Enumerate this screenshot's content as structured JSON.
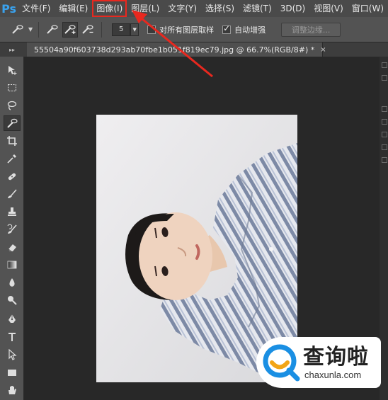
{
  "app": {
    "logo": "Ps"
  },
  "menu": {
    "items": [
      {
        "label": "文件(F)"
      },
      {
        "label": "编辑(E)"
      },
      {
        "label": "图像(I)",
        "highlighted": true
      },
      {
        "label": "图层(L)"
      },
      {
        "label": "文字(Y)"
      },
      {
        "label": "选择(S)"
      },
      {
        "label": "滤镜(T)"
      },
      {
        "label": "3D(D)"
      },
      {
        "label": "视图(V)"
      },
      {
        "label": "窗口(W)"
      }
    ],
    "highlight_color": "#e8281f"
  },
  "options": {
    "brush_size": "5",
    "sample_all_layers_label": "对所有图层取样",
    "sample_all_layers_checked": false,
    "auto_enhance_label": "自动增强",
    "auto_enhance_checked": true,
    "refine_edge_label": "调整边缘..."
  },
  "document": {
    "tab_title": "55504a90f603738d293ab70fbe1b051f819ec79.jpg @ 66.7%(RGB/8#) *",
    "close_glyph": "×"
  },
  "tools": [
    {
      "icon": "move-icon"
    },
    {
      "icon": "marquee-icon"
    },
    {
      "icon": "lasso-icon"
    },
    {
      "icon": "quick-selection-icon",
      "active": true
    },
    {
      "icon": "crop-icon"
    },
    {
      "icon": "eyedropper-icon"
    },
    {
      "icon": "healing-brush-icon"
    },
    {
      "icon": "brush-icon"
    },
    {
      "icon": "clone-stamp-icon"
    },
    {
      "icon": "history-brush-icon"
    },
    {
      "icon": "eraser-icon"
    },
    {
      "icon": "gradient-icon"
    },
    {
      "icon": "blur-icon"
    },
    {
      "icon": "dodge-icon"
    },
    {
      "icon": "pen-icon"
    },
    {
      "icon": "type-icon"
    },
    {
      "icon": "path-selection-icon"
    },
    {
      "icon": "rectangle-icon"
    },
    {
      "icon": "hand-icon"
    }
  ],
  "watermark": {
    "brand": "查询啦",
    "url": "chaxunla.com",
    "accent": "#1a8fe3"
  }
}
